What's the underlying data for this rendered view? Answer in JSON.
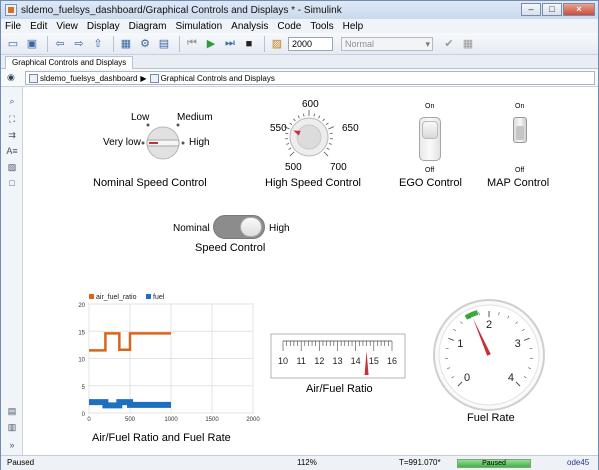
{
  "window": {
    "title": "sldemo_fuelsys_dashboard/Graphical Controls and Displays * - Simulink"
  },
  "menu": [
    "File",
    "Edit",
    "View",
    "Display",
    "Diagram",
    "Simulation",
    "Analysis",
    "Code",
    "Tools",
    "Help"
  ],
  "toolbar": {
    "stop_time": "2000",
    "sim_mode": "Normal"
  },
  "tab": {
    "label": "Graphical Controls and Displays"
  },
  "breadcrumb": {
    "model": "sldemo_fuelsys_dashboard",
    "subsystem": "Graphical Controls and Displays"
  },
  "knob_nominal": {
    "labels": {
      "low": "Low",
      "medium": "Medium",
      "very_low": "Very low",
      "high": "High"
    },
    "caption": "Nominal Speed Control"
  },
  "knob_high": {
    "ticks": [
      "500",
      "550",
      "600",
      "650",
      "700"
    ],
    "caption": "High Speed Control",
    "value": 550
  },
  "ego": {
    "on": "On",
    "off": "Off",
    "caption": "EGO Control",
    "state": "on"
  },
  "map": {
    "on": "On",
    "off": "Off",
    "caption": "MAP Control",
    "state": "on"
  },
  "speed_switch": {
    "left": "Nominal",
    "right": "High",
    "caption": "Speed Control",
    "state": "High"
  },
  "scope": {
    "caption": "Air/Fuel Ratio and Fuel Rate"
  },
  "gauge_linear": {
    "ticks": [
      "10",
      "11",
      "12",
      "13",
      "14",
      "15",
      "16"
    ],
    "caption": "Air/Fuel Ratio",
    "value": 14.6
  },
  "gauge_circular": {
    "ticks": [
      "0",
      "1",
      "2",
      "3",
      "4"
    ],
    "caption": "Fuel Rate",
    "value": 1.65
  },
  "status": {
    "state": "Paused",
    "zoom": "112%",
    "time": "T=991.070*",
    "progress_label": "Paused",
    "solver": "ode45"
  },
  "chart_data": {
    "type": "line",
    "title": "",
    "xlim": [
      0,
      2000
    ],
    "ylim": [
      0,
      20
    ],
    "x_ticks": [
      "0",
      "500",
      "1000",
      "1500",
      "2000"
    ],
    "y_ticks": [
      "0",
      "5",
      "10",
      "15",
      "20"
    ],
    "grid": true,
    "legend_position": "top-left",
    "series": [
      {
        "name": "air_fuel_ratio",
        "color": "#d9651b",
        "x": [
          0,
          200,
          200,
          370,
          370,
          500,
          500,
          670,
          670,
          1000
        ],
        "y": [
          11.5,
          11.5,
          14.6,
          14.6,
          11.6,
          11.6,
          14.6,
          14.6,
          14.6,
          14.6
        ]
      },
      {
        "name": "fuel",
        "color": "#1f6fc0",
        "x": [
          0,
          200,
          200,
          370,
          370,
          500,
          500,
          670,
          670,
          1000
        ],
        "y": [
          2.0,
          2.0,
          1.4,
          1.4,
          2.0,
          2.0,
          1.5,
          1.5,
          1.5,
          1.5
        ]
      }
    ]
  },
  "colors": {
    "accent": "#d9651b",
    "fuel": "#1f6fc0",
    "needle": "#c8303a"
  },
  "icons": [
    "save-icon",
    "back-icon",
    "forward-icon",
    "up-icon",
    "library-icon",
    "settings-icon",
    "run-icon",
    "step-forward-icon",
    "step-back-icon",
    "stop-icon",
    "scope-icon",
    "zoom-icon",
    "fit-icon",
    "arrow-icon",
    "annotation-icon",
    "image-icon",
    "box-icon"
  ]
}
